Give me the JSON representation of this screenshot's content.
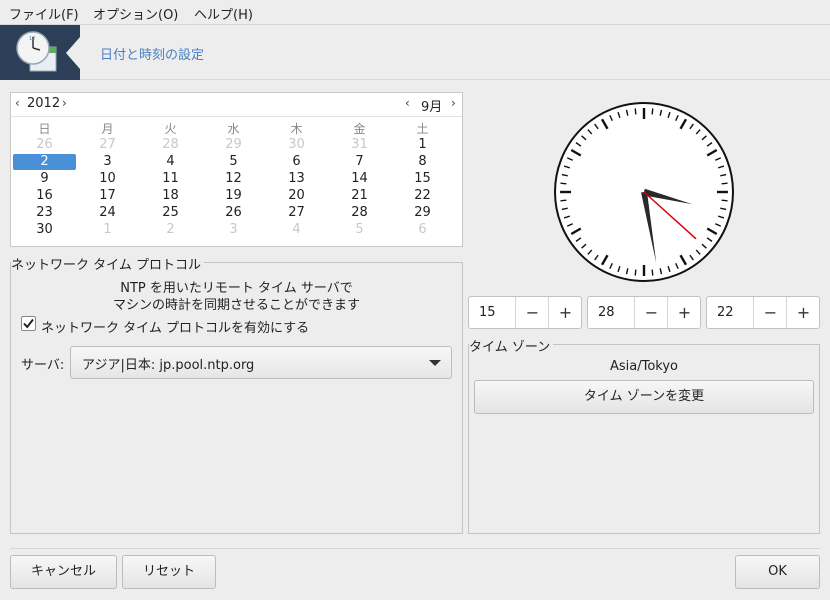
{
  "menubar": {
    "items": [
      {
        "label": "ファイル(F)"
      },
      {
        "label": "オプション(O)"
      },
      {
        "label": "ヘルプ(H)"
      }
    ]
  },
  "banner": {
    "title": "日付と時刻の設定",
    "icon": "clock-calendar-icon"
  },
  "calendar": {
    "year": "2012",
    "month": "9月",
    "weekdays": [
      "日",
      "月",
      "火",
      "水",
      "木",
      "金",
      "土"
    ],
    "weeks": [
      [
        "26",
        "27",
        "28",
        "29",
        "30",
        "31",
        "1"
      ],
      [
        "2",
        "3",
        "4",
        "5",
        "6",
        "7",
        "8"
      ],
      [
        "9",
        "10",
        "11",
        "12",
        "13",
        "14",
        "15"
      ],
      [
        "16",
        "17",
        "18",
        "19",
        "20",
        "21",
        "22"
      ],
      [
        "23",
        "24",
        "25",
        "26",
        "27",
        "28",
        "29"
      ],
      [
        "30",
        "1",
        "2",
        "3",
        "4",
        "5",
        "6"
      ]
    ],
    "selected": "2"
  },
  "ntp": {
    "group_label": "ネットワーク タイム プロトコル",
    "desc_line1": "NTP を用いたリモート タイム サーバで",
    "desc_line2": "マシンの時計を同期させることができます",
    "enable_label": "ネットワーク タイム プロトコルを有効にする",
    "enabled": true,
    "server_label": "サーバ:",
    "server_value": "アジア|日本: jp.pool.ntp.org"
  },
  "time": {
    "hour": "15",
    "minute": "28",
    "second": "22",
    "minus": "−",
    "plus": "+"
  },
  "timezone": {
    "group_label": "タイム ゾーン",
    "name": "Asia/Tokyo",
    "change_label": "タイム ゾーンを変更"
  },
  "buttons": {
    "cancel": "キャンセル",
    "reset": "リセット",
    "ok": "OK"
  },
  "colors": {
    "accent": "#4a90d9",
    "banner_bg": "#2c3e58",
    "title": "#4a7fc1",
    "second_hand": "#dd0000"
  }
}
